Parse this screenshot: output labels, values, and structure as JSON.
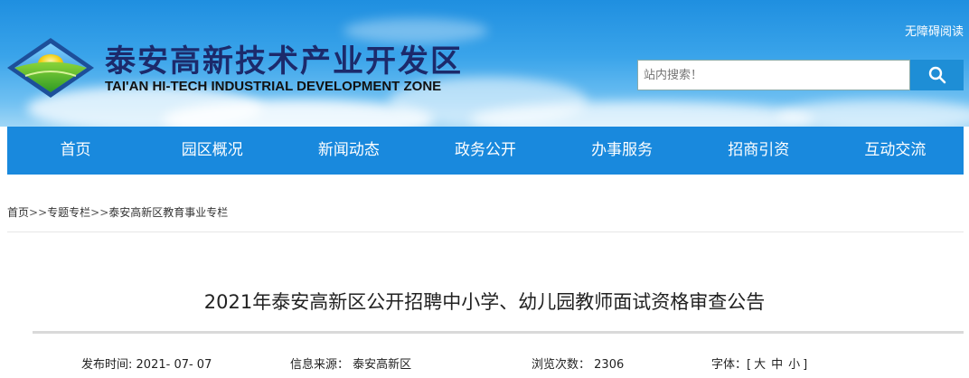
{
  "header": {
    "site_title": "泰安高新技术产业开发区",
    "site_subtitle": "TAI'AN HI-TECH INDUSTRIAL DEVELOPMENT ZONE",
    "accessibility_link": "无障碍阅读",
    "search": {
      "placeholder": "站内搜索！"
    },
    "colors": {
      "nav_bg": "#1989dd",
      "title_color": "#1c2a6b",
      "search_button": "#1e8ed6"
    }
  },
  "nav": {
    "items": [
      {
        "label": "首页"
      },
      {
        "label": "园区概况"
      },
      {
        "label": "新闻动态"
      },
      {
        "label": "政务公开"
      },
      {
        "label": "办事服务"
      },
      {
        "label": "招商引资"
      },
      {
        "label": "互动交流"
      }
    ]
  },
  "breadcrumb": {
    "items": [
      "首页",
      "专题专栏",
      "泰安高新区教育事业专栏"
    ],
    "separator": ">>"
  },
  "article": {
    "title": "2021年泰安高新区公开招聘中小学、幼儿园教师面试资格审查公告",
    "meta": {
      "publish_label": "发布时间:",
      "publish_value": "2021- 07- 07",
      "source_label": "信息来源：",
      "source_value": "泰安高新区",
      "views_label": "浏览次数：",
      "views_value": "2306",
      "font_label": "字体：[",
      "font_large": "大",
      "font_medium": "中",
      "font_small": "小",
      "font_close": "]"
    }
  }
}
